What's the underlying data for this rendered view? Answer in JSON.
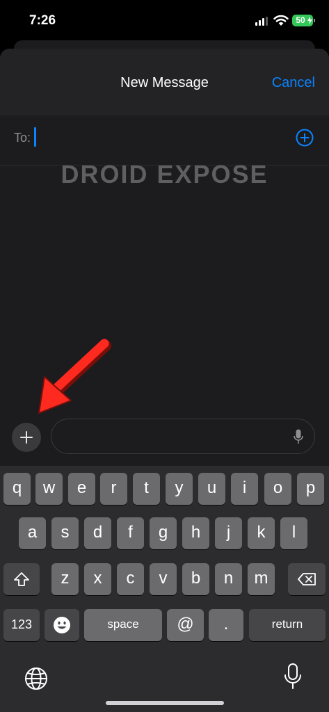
{
  "status_bar": {
    "time": "7:26",
    "battery": "50"
  },
  "header": {
    "title": "New Message",
    "cancel_label": "Cancel"
  },
  "recipient": {
    "to_label": "To:"
  },
  "watermark": "DROID EXPOSE",
  "keyboard": {
    "row1": [
      "q",
      "w",
      "e",
      "r",
      "t",
      "y",
      "u",
      "i",
      "o",
      "p"
    ],
    "row2": [
      "a",
      "s",
      "d",
      "f",
      "g",
      "h",
      "j",
      "k",
      "l"
    ],
    "row3": [
      "z",
      "x",
      "c",
      "v",
      "b",
      "n",
      "m"
    ],
    "numbers_label": "123",
    "space_label": "space",
    "at_label": "@",
    "period_label": ".",
    "return_label": "return"
  },
  "icons": {
    "add_recipient": "plus-circle-icon",
    "apps": "plus-icon",
    "dictation": "microphone-icon",
    "shift": "shift-arrow-icon",
    "delete": "backspace-icon",
    "emoji": "emoji-icon",
    "keyboard_switch": "globe-icon",
    "annotation": "red-arrow-icon"
  },
  "colors": {
    "accent": "#0a84ff",
    "annotation": "#ff2a1f",
    "battery": "#34c759"
  }
}
